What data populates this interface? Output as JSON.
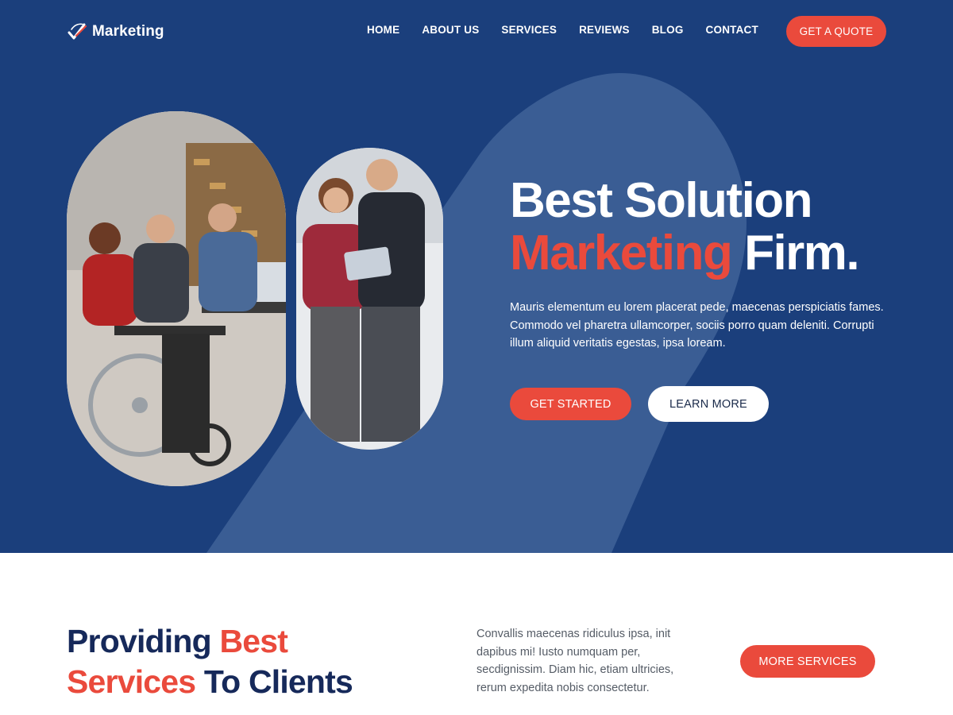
{
  "brand": {
    "name": "Marketing",
    "logo_icon": "checkmark-swoosh-icon"
  },
  "nav": {
    "items": [
      {
        "label": "HOME"
      },
      {
        "label": "ABOUT US"
      },
      {
        "label": "SERVICES"
      },
      {
        "label": "REVIEWS"
      },
      {
        "label": "BLOG"
      },
      {
        "label": "CONTACT"
      }
    ],
    "cta_label": "GET A QUOTE"
  },
  "hero": {
    "title_line1": "Best Solution",
    "title_accent": "Marketing",
    "title_end": " Firm.",
    "description": "Mauris elementum eu lorem placerat pede, maecenas perspiciatis fames. Commodo vel pharetra ullamcorper, sociis porro quam deleniti. Corrupti illum aliquid veritatis egestas, ipsa loream.",
    "primary_button": "GET STARTED",
    "secondary_button": "LEARN MORE"
  },
  "services": {
    "title_part1": "Providing ",
    "title_accent1": "Best",
    "title_accent2": "Services",
    "title_part2": " To Clients",
    "text": "Convallis maecenas ridiculus ipsa, init dapibus mi! Iusto numquam per, secdignissim. Diam hic, etiam ultricies, rerum expedita nobis consectetur.",
    "button": "MORE SERVICES"
  },
  "colors": {
    "hero_bg": "#1b3f7c",
    "accent": "#ea4a3c",
    "heading_dark": "#16295a"
  }
}
